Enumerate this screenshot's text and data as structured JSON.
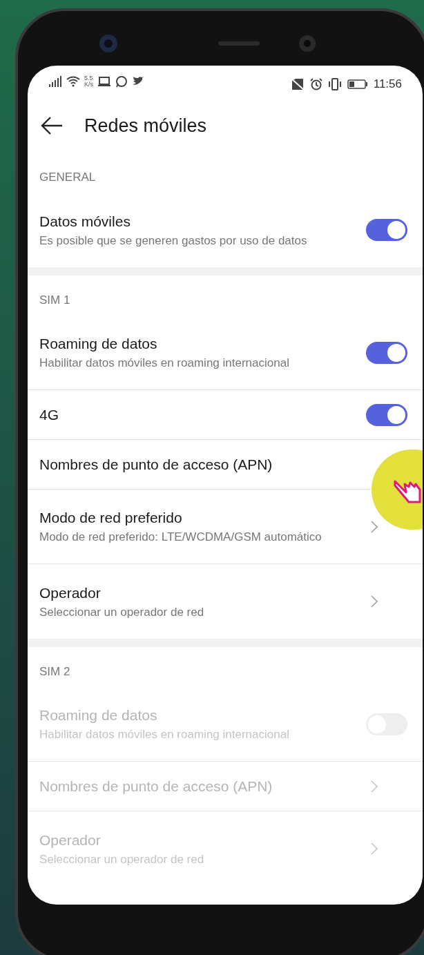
{
  "status_bar": {
    "speed_value": "5.5",
    "speed_unit": "K/s",
    "time": "11:56"
  },
  "header": {
    "title": "Redes móviles"
  },
  "sections": [
    {
      "title": "GENERAL",
      "items": [
        {
          "kind": "toggle",
          "title": "Datos móviles",
          "subtitle": "Es posible que se generen gastos por uso de datos",
          "on": true,
          "disabled": false
        }
      ]
    },
    {
      "title": "SIM 1",
      "items": [
        {
          "kind": "toggle",
          "title": "Roaming de datos",
          "subtitle": "Habilitar datos móviles en roaming internacional",
          "on": true,
          "disabled": false
        },
        {
          "kind": "toggle",
          "title": "4G",
          "on": true,
          "disabled": false
        },
        {
          "kind": "plain",
          "title": "Nombres de punto de acceso (APN)",
          "disabled": false
        },
        {
          "kind": "link",
          "title": "Modo de red preferido",
          "subtitle": "Modo de red preferido: LTE/WCDMA/GSM automático",
          "disabled": false
        },
        {
          "kind": "link",
          "title": "Operador",
          "subtitle": "Seleccionar un operador de red",
          "disabled": false
        }
      ]
    },
    {
      "title": "SIM 2",
      "items": [
        {
          "kind": "toggle",
          "title": "Roaming de datos",
          "subtitle": "Habilitar datos móviles en roaming internacional",
          "on": false,
          "disabled": true
        },
        {
          "kind": "link",
          "title": "Nombres de punto de acceso (APN)",
          "disabled": true
        },
        {
          "kind": "link",
          "title": "Operador",
          "subtitle": "Seleccionar un operador de red",
          "disabled": true
        }
      ]
    }
  ]
}
